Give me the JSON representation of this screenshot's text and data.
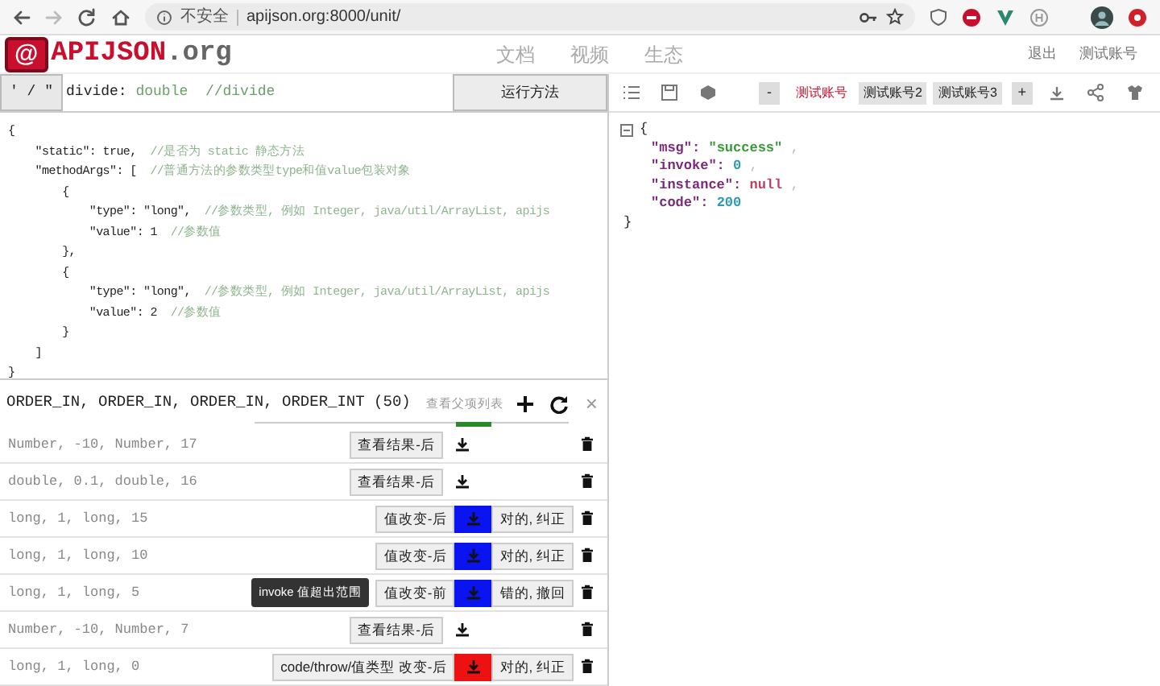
{
  "browser": {
    "security": "不安全",
    "url": "apijson.org:8000/unit/"
  },
  "header": {
    "logo_mark": "@",
    "logo_name": "APIJSON",
    "logo_suffix": ".org",
    "nav": [
      "文档",
      "视频",
      "生态"
    ],
    "actions": [
      "退出",
      "测试账号"
    ]
  },
  "method_bar": {
    "quote_button": "' / \"",
    "method_name": "divide",
    "method_sep": ": ",
    "return_type": "double",
    "comment": "//divide",
    "run_button": "运行方法"
  },
  "editor": {
    "lines": [
      {
        "code": "{"
      },
      {
        "code": "    \"static\": true,  ",
        "comment": "//是否为 static 静态方法"
      },
      {
        "code": "    \"methodArgs\": [  ",
        "comment": "//普通方法的参数类型type和值value包装对象"
      },
      {
        "code": "        {"
      },
      {
        "code": "            \"type\": \"long\",  ",
        "comment": "//参数类型, 例如 Integer, java/util/ArrayList, apijs"
      },
      {
        "code": "            \"value\": 1  ",
        "comment": "//参数值"
      },
      {
        "code": "        },"
      },
      {
        "code": "        {"
      },
      {
        "code": "            \"type\": \"long\",  ",
        "comment": "//参数类型, 例如 Integer, java/util/ArrayList, apijs"
      },
      {
        "code": "            \"value\": 2  ",
        "comment": "//参数值"
      },
      {
        "code": "        }"
      },
      {
        "code": "    ]"
      },
      {
        "code": "}"
      }
    ]
  },
  "test_list": {
    "title": "ORDER_IN, ORDER_IN, ORDER_IN, ORDER_INT (50)",
    "parent_link": "查看父项列表",
    "close": "×",
    "rows": [
      {
        "args": "Number, -10, Number, 17",
        "kind": "result",
        "result_button": "查看结果-后"
      },
      {
        "args": "double, 0.1, double, 16",
        "kind": "result",
        "result_button": "查看结果-后"
      },
      {
        "args": "long, 1, long, 15",
        "kind": "changed",
        "result_button": "值改变-后",
        "color": "#0a14f0",
        "judge_button": "对的, 纠正"
      },
      {
        "args": "long, 1, long, 10",
        "kind": "changed",
        "result_button": "值改变-后",
        "color": "#0a14f0",
        "judge_button": "对的, 纠正"
      },
      {
        "args": "long, 1, long, 5",
        "kind": "changed",
        "result_button": "值改变-前",
        "color": "#0a14f0",
        "judge_button": "错的, 撤回",
        "tooltip": "invoke 值超出范围"
      },
      {
        "args": "Number, -10, Number, 7",
        "kind": "result",
        "result_button": "查看结果-后"
      },
      {
        "args": "long, 1, long, 0",
        "kind": "changed",
        "result_button": "code/throw/值类型 改变-后",
        "color": "#ee1111",
        "judge_button": "对的, 纠正"
      }
    ]
  },
  "accounts": {
    "minus": "-",
    "plus": "+",
    "tabs": [
      {
        "label": "测试账号",
        "selected": true
      },
      {
        "label": "测试账号2",
        "selected": false
      },
      {
        "label": "测试账号3",
        "selected": false
      }
    ]
  },
  "response": {
    "open": "{",
    "close": "}",
    "fields": [
      {
        "key": "\"msg\":",
        "value": "\"success\"",
        "kind": "string",
        "sep": " ,"
      },
      {
        "key": "\"invoke\":",
        "value": "0",
        "kind": "number",
        "sep": " ,"
      },
      {
        "key": "\"instance\":",
        "value": "null",
        "kind": "null",
        "sep": " ,"
      },
      {
        "key": "\"code\":",
        "value": "200",
        "kind": "number"
      }
    ]
  }
}
